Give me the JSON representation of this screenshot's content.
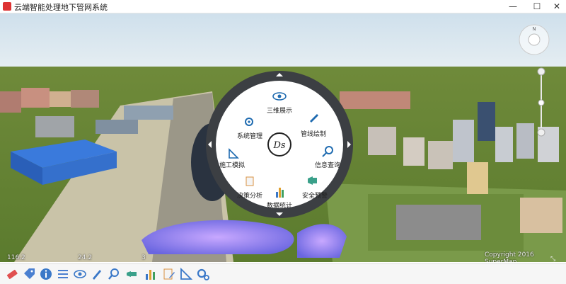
{
  "window": {
    "title": "云端智能处理地下管网系统",
    "min": "—",
    "max": "☐",
    "close": "✕"
  },
  "radial_menu": {
    "center_logo": "Ds",
    "items": [
      {
        "label": "三维展示"
      },
      {
        "label": "管线绘制"
      },
      {
        "label": "信息查询"
      },
      {
        "label": "安全预警"
      },
      {
        "label": "数据统计"
      },
      {
        "label": "决策分析"
      },
      {
        "label": "施工模拟"
      },
      {
        "label": "系统管理"
      }
    ]
  },
  "copyright": "Copyright 2016 SuperMap",
  "coords": {
    "left": "116.2",
    "mid": "24.2",
    "right": "3"
  },
  "toolbar": {
    "items": [
      {
        "icon": "eraser-icon",
        "color": "#e05050"
      },
      {
        "icon": "tag-icon",
        "color": "#4a7fd0"
      },
      {
        "icon": "info-icon",
        "color": "#3a78c8"
      },
      {
        "icon": "list-icon",
        "color": "#4a7fd0"
      },
      {
        "icon": "eye-icon",
        "color": "#3a78c8"
      },
      {
        "icon": "pencil-icon",
        "color": "#3a78c8"
      },
      {
        "icon": "search-icon",
        "color": "#3a78c8"
      },
      {
        "icon": "speaker-icon",
        "color": "#3aa08a"
      },
      {
        "icon": "bar-chart-icon",
        "color": "#e0a030"
      },
      {
        "icon": "document-pen-icon",
        "color": "#4a7fd0"
      },
      {
        "icon": "ruler-pen-icon",
        "color": "#3a78c8"
      },
      {
        "icon": "gears-icon",
        "color": "#3a78c8"
      }
    ]
  }
}
